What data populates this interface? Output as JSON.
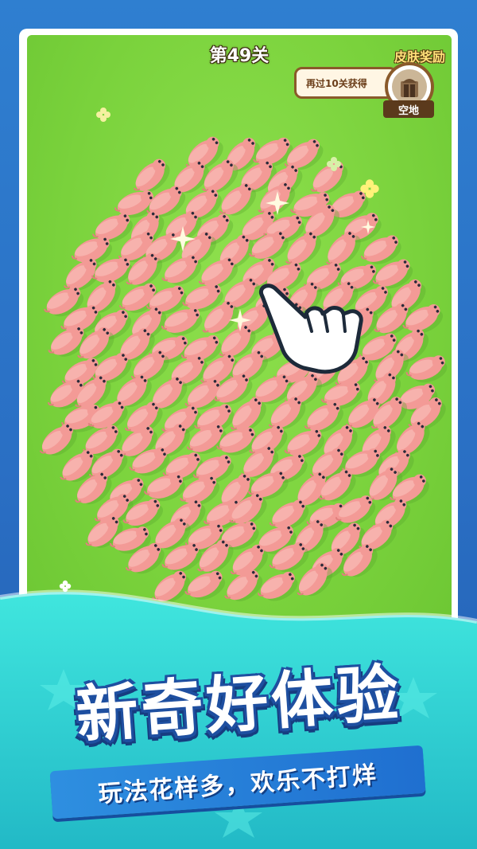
{
  "level": {
    "title": "第49关"
  },
  "reward": {
    "title": "皮肤奖励",
    "progress_text": "再过10关获得",
    "skin_name": "空地"
  },
  "promo": {
    "headline": "新奇好体验",
    "subtitle": "玩法花样多，欢乐不打烊"
  },
  "colors": {
    "background_blue": "#2a6fc4",
    "field_green": "#7ad23c",
    "pig_pink": "#f08a8a",
    "wave_teal": "#2fd6cf"
  },
  "icons": [
    "hand-pointer-icon",
    "sparkle-icon",
    "clover-icon",
    "door-icon"
  ]
}
